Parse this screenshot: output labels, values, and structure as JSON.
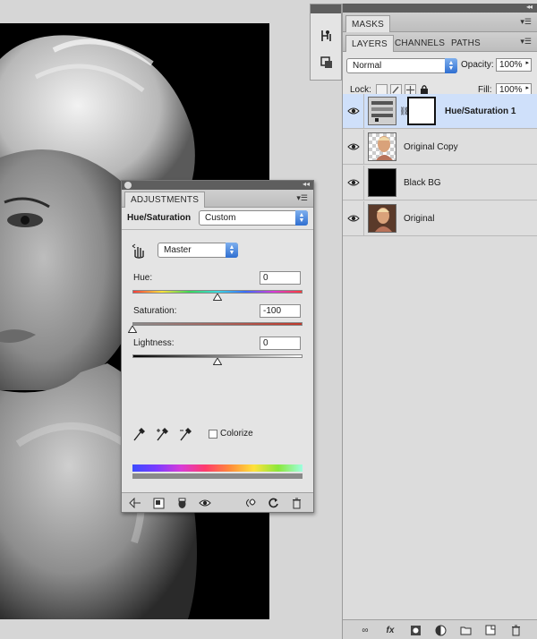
{
  "masks_panel": {
    "tab": "MASKS"
  },
  "layers_panel": {
    "tabs": [
      "LAYERS",
      "CHANNELS",
      "PATHS"
    ],
    "blend_mode": "Normal",
    "opacity_label": "Opacity:",
    "opacity_value": "100%",
    "lock_label": "Lock:",
    "fill_label": "Fill:",
    "fill_value": "100%",
    "layers": [
      {
        "name": "Hue/Saturation 1",
        "selected": true
      },
      {
        "name": "Original Copy",
        "selected": false
      },
      {
        "name": "Black BG",
        "selected": false
      },
      {
        "name": "Original",
        "selected": false
      }
    ]
  },
  "adjustments_panel": {
    "tab": "ADJUSTMENTS",
    "adjustment_type": "Hue/Saturation",
    "preset": "Custom",
    "channel": "Master",
    "hue_label": "Hue:",
    "hue_value": "0",
    "hue_fraction": 0.5,
    "saturation_label": "Saturation:",
    "saturation_value": "-100",
    "saturation_fraction": 0.0,
    "lightness_label": "Lightness:",
    "lightness_value": "0",
    "lightness_fraction": 0.5,
    "colorize_label": "Colorize",
    "colorize_checked": false
  },
  "icons": {
    "mini_dock": [
      "adjustments-icon",
      "masks-icon"
    ],
    "layers_bottom": [
      "link-layers-icon",
      "fx-icon",
      "add-mask-icon",
      "new-adjustment-icon",
      "new-group-icon",
      "new-layer-icon",
      "delete-layer-icon"
    ],
    "adjustments_bottom": [
      "back-arrow-icon",
      "expand-view-icon",
      "clip-layer-icon",
      "visibility-eye-icon",
      "view-previous-icon",
      "reset-icon",
      "delete-adjustment-icon"
    ]
  },
  "colors": {
    "selection": "#cfe0fa",
    "panel_bg": "#e4e4e4",
    "titlebar": "#5e5e5e",
    "stepper_blue": "#2f6fd1"
  }
}
